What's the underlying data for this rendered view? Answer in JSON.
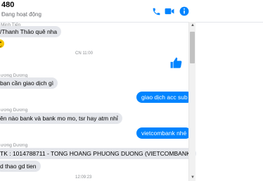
{
  "header": {
    "title": "480",
    "status": "Đang hoạt động",
    "icons": [
      "phone-icon",
      "video-icon",
      "info-icon"
    ],
    "accent": "#0084ff"
  },
  "messages": {
    "sender_1": "Minh Tiến",
    "msg_1": "/Thanh Thảo quê nha",
    "time_1": "CN 11:00",
    "sender_2": "ương Dương",
    "msg_2": "bạn cần giao dịch gì",
    "reply_1": "giao dịch acc sub",
    "sender_3": "ương Dương",
    "msg_3": "ên nào bank và bank mo mo, tsr hay atm nhỉ",
    "reply_2": "vietcombank nhé",
    "sender_4": "ương Dương",
    "msg_4": "TK : 1014788711 - TONG HOANG PHUONG DUONG (VIETCOMBANK)",
    "msg_5": "d thao gd tien",
    "time_2": "12:09:23"
  }
}
